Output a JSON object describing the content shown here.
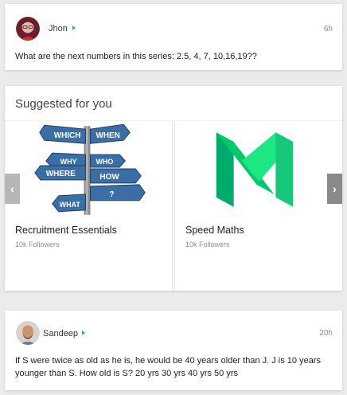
{
  "post1": {
    "author": "Jhon",
    "time": "6h",
    "text": "What are the next numbers in this series: 2.5, 4, 7, 10,16,19??"
  },
  "suggested": {
    "title": "Suggested for you",
    "items": [
      {
        "name": "Recruitment Essentials",
        "followers": "10k Followers",
        "image": "signpost-illustration",
        "sign_words": [
          "WHICH",
          "WHEN",
          "WHY",
          "WHO",
          "WHERE",
          "HOW",
          "WHAT",
          "?"
        ]
      },
      {
        "name": "Speed Maths",
        "followers": "10k Followers",
        "image": "green-m-logo"
      }
    ],
    "prev_icon": "chevron-left-icon",
    "next_icon": "chevron-right-icon",
    "prev_glyph": "‹",
    "next_glyph": "›"
  },
  "post2": {
    "author": "Sandeep",
    "time": "20h",
    "text": "If S were twice as old as he is, he would be 40 years older than J. J is 10 years younger than S. How old is S? 20 yrs 30 yrs 40 yrs 50 yrs"
  },
  "colors": {
    "background": "#ebebeb",
    "follow_arrow": "#2bbf63",
    "sign_blue": "#3a6ea5",
    "logo_green_dark": "#00ab6c",
    "logo_green_light": "#1ce783"
  }
}
